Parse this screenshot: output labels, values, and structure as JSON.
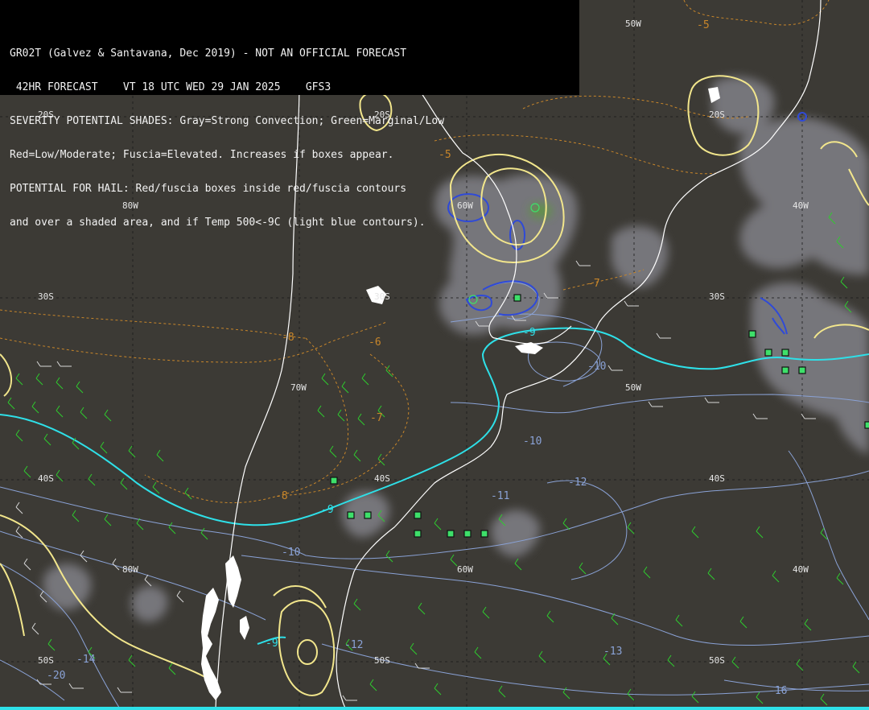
{
  "header": {
    "line1": "GR02T (Galvez & Santavana, Dec 2019) - NOT AN OFFICIAL FORECAST",
    "line2": " 42HR FORECAST    VT 18 UTC WED 29 JAN 2025    GFS3",
    "line3": "SEVERITY POTENTIAL SHADES: Gray=Strong Convection; Green=Marginal/Low",
    "line4": "Red=Low/Moderate; Fuscia=Elevated. Increases if boxes appear.",
    "line5": "POTENTIAL FOR HAIL: Red/fuscia boxes inside red/fuscia contours",
    "line6": "and over a shaded area, and if Temp 500<-9C (light blue contours)."
  },
  "grid_labels": [
    {
      "id": "lon-50w-top",
      "text": "50W"
    },
    {
      "id": "lat-20s-left",
      "text": "20S"
    },
    {
      "id": "lat-20s-mid",
      "text": "20S"
    },
    {
      "id": "lat-20s-right",
      "text": "20S"
    },
    {
      "id": "lon-80w-upper",
      "text": "80W"
    },
    {
      "id": "lon-60w-upper",
      "text": "60W"
    },
    {
      "id": "lon-40w-upper",
      "text": "40W"
    },
    {
      "id": "lat-30s-left",
      "text": "30S"
    },
    {
      "id": "lat-30s-mid",
      "text": "30S"
    },
    {
      "id": "lat-30s-right",
      "text": "30S"
    },
    {
      "id": "lon-70w-mid",
      "text": "70W"
    },
    {
      "id": "lon-50w-mid",
      "text": "50W"
    },
    {
      "id": "lat-40s-left",
      "text": "40S"
    },
    {
      "id": "lat-40s-mid",
      "text": "40S"
    },
    {
      "id": "lat-40s-right",
      "text": "40S"
    },
    {
      "id": "lon-80w-lower",
      "text": "80W"
    },
    {
      "id": "lon-60w-lower",
      "text": "60W"
    },
    {
      "id": "lon-40w-lower",
      "text": "40W"
    },
    {
      "id": "lat-50s-left",
      "text": "50S"
    },
    {
      "id": "lat-50s-mid",
      "text": "50S"
    },
    {
      "id": "lat-50s-right",
      "text": "50S"
    }
  ],
  "temp_labels": [
    {
      "id": "t-5-topright",
      "text": "-5",
      "color": "#c8862a"
    },
    {
      "id": "t-5-brazil",
      "text": "-5",
      "color": "#c8862a"
    },
    {
      "id": "t-6-mid",
      "text": "-6",
      "color": "#c8862a"
    },
    {
      "id": "t-7-uruguay",
      "text": "-7",
      "color": "#c8862a"
    },
    {
      "id": "t-8-andes",
      "text": "-8",
      "color": "#c8862a"
    },
    {
      "id": "t-7-arg",
      "text": "-7",
      "color": "#c8862a"
    },
    {
      "id": "t-8-patag",
      "text": "-8",
      "color": "#c8862a"
    },
    {
      "id": "t-9-bsas",
      "text": "-9",
      "color": "#2ee0e8"
    },
    {
      "id": "t-9-patag",
      "text": "-9",
      "color": "#2ee0e8"
    },
    {
      "id": "t-9-south",
      "text": "-9",
      "color": "#2ee0e8"
    },
    {
      "id": "t-10-atl",
      "text": "-10",
      "color": "#8aa2d6"
    },
    {
      "id": "t-10-atl2",
      "text": "-10",
      "color": "#8aa2d6"
    },
    {
      "id": "t-10-patag",
      "text": "-10",
      "color": "#8aa2d6"
    },
    {
      "id": "t-11",
      "text": "-11",
      "color": "#8aa2d6"
    },
    {
      "id": "t-12-atl",
      "text": "-12",
      "color": "#8aa2d6"
    },
    {
      "id": "t-12-south",
      "text": "-12",
      "color": "#8aa2d6"
    },
    {
      "id": "t-13",
      "text": "-13",
      "color": "#8aa2d6"
    },
    {
      "id": "t-14",
      "text": "-14",
      "color": "#8aa2d6"
    },
    {
      "id": "t-16",
      "text": "-16",
      "color": "#8aa2d6"
    },
    {
      "id": "t-20",
      "text": "-20",
      "color": "#8aa2d6"
    }
  ],
  "colors": {
    "background": "#3c3a35",
    "coast": "#ffffff",
    "convection_shade": "#8a8a93",
    "marginal_shade": "#5c9a3c",
    "severity_contour": "#f2e68c",
    "hail_temp_contour": "#2ee0e8",
    "temp_contour": "#8aa2d6",
    "warm_contour": "#c8862a",
    "wind_barb_green": "#2ecc2e",
    "wind_barb_white": "#d8d8d8",
    "hail_box": "#3ee06a"
  }
}
